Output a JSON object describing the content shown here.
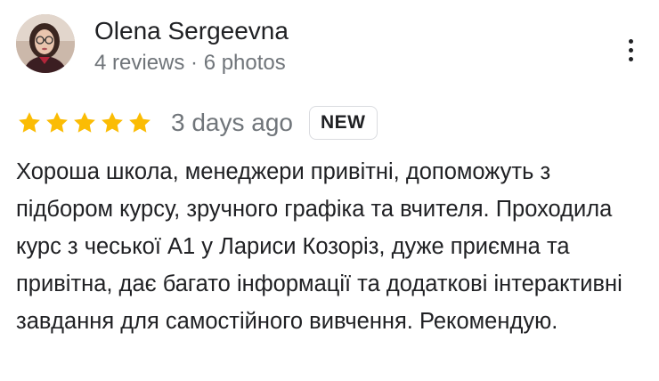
{
  "review": {
    "author": {
      "name": "Olena Sergeevna",
      "meta": "4 reviews · 6 photos",
      "avatar_icon": "profile-photo"
    },
    "more_icon": "more-vert-icon",
    "rating": 5,
    "rating_max": 5,
    "star_color": "#fbbc04",
    "time_ago": "3 days ago",
    "badge": "NEW",
    "text": "Хороша школа, менеджери привітні, допоможуть з підбором курсу, зручного графіка та вчителя. Проходила курс з чеської А1 у Лариси Козоріз, дуже приємна та привітна, дає багато інформації та додаткові інтерактивні завдання для самостійного вивчення. Рекомендую."
  }
}
